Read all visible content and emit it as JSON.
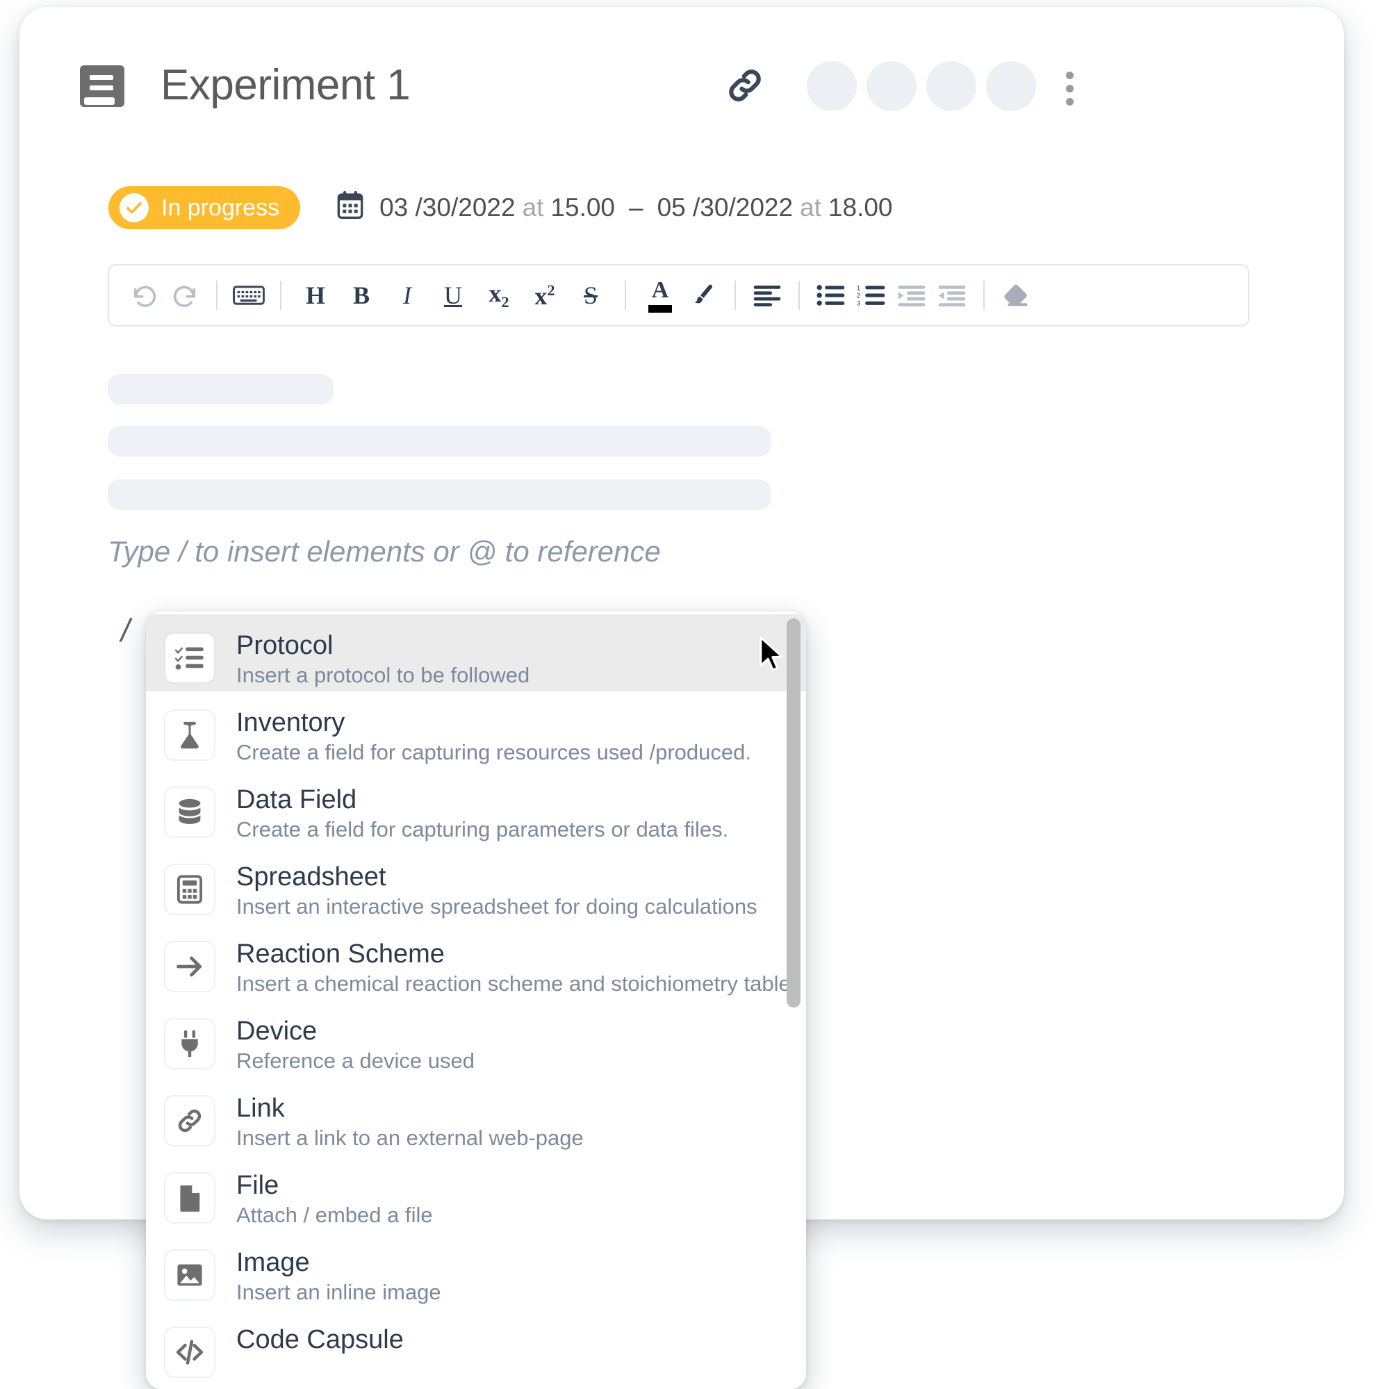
{
  "header": {
    "title": "Experiment 1",
    "book_icon": "book-icon",
    "link_icon": "link-icon",
    "more_icon": "more-vertical-icon",
    "avatar_count": 4
  },
  "meta": {
    "status_label": "In progress",
    "status_color": "#FDBB2D",
    "check_icon": "check-circle-icon",
    "calendar_icon": "calendar-icon",
    "start_date": "03 /30/2022",
    "start_at": "at",
    "start_time": "15.00",
    "range_dash": "–",
    "end_date": "05 /30/2022",
    "end_at": "at",
    "end_time": "18.00"
  },
  "toolbar": {
    "items": [
      {
        "name": "undo-icon",
        "label": "",
        "type": "icon"
      },
      {
        "name": "redo-icon",
        "label": "",
        "type": "icon"
      },
      {
        "name": "separator",
        "label": "",
        "type": "sep"
      },
      {
        "name": "keyboard-icon",
        "label": "",
        "type": "icon"
      },
      {
        "name": "separator",
        "label": "",
        "type": "sep"
      },
      {
        "name": "heading-button",
        "label": "H",
        "type": "text"
      },
      {
        "name": "bold-button",
        "label": "B",
        "type": "text"
      },
      {
        "name": "italic-button",
        "label": "I",
        "type": "text"
      },
      {
        "name": "underline-button",
        "label": "U",
        "type": "text"
      },
      {
        "name": "subscript-button",
        "label": "x2",
        "type": "text"
      },
      {
        "name": "superscript-button",
        "label": "x2",
        "type": "text"
      },
      {
        "name": "strikethrough-button",
        "label": "S",
        "type": "text"
      },
      {
        "name": "separator",
        "label": "",
        "type": "sep"
      },
      {
        "name": "text-color-button",
        "label": "A",
        "type": "text"
      },
      {
        "name": "highlight-brush-icon",
        "label": "",
        "type": "icon"
      },
      {
        "name": "separator",
        "label": "",
        "type": "sep"
      },
      {
        "name": "align-left-icon",
        "label": "",
        "type": "icon"
      },
      {
        "name": "separator",
        "label": "",
        "type": "sep"
      },
      {
        "name": "bulleted-list-icon",
        "label": "",
        "type": "icon"
      },
      {
        "name": "numbered-list-icon",
        "label": "",
        "type": "icon"
      },
      {
        "name": "indent-icon",
        "label": "",
        "type": "icon"
      },
      {
        "name": "outdent-icon",
        "label": "",
        "type": "icon"
      },
      {
        "name": "separator",
        "label": "",
        "type": "sep"
      },
      {
        "name": "eraser-icon",
        "label": "",
        "type": "icon"
      }
    ]
  },
  "editor": {
    "hint": "Type / to insert elements or @ to reference",
    "typed_text": "/"
  },
  "slash_menu": {
    "items": [
      {
        "title": "Protocol",
        "desc": "Insert a protocol to be followed",
        "icon": "checklist-icon",
        "active": true
      },
      {
        "title": "Inventory",
        "desc": "Create a field for capturing resources used /produced.",
        "icon": "flask-icon",
        "active": false
      },
      {
        "title": "Data Field",
        "desc": "Create a field for capturing parameters or data files.",
        "icon": "database-icon",
        "active": false
      },
      {
        "title": "Spreadsheet",
        "desc": "Insert an interactive spreadsheet for doing calculations",
        "icon": "calculator-icon",
        "active": false
      },
      {
        "title": "Reaction Scheme",
        "desc": "Insert a chemical reaction scheme and stoichiometry table",
        "icon": "arrow-right-icon",
        "active": false
      },
      {
        "title": "Device",
        "desc": "Reference a device used",
        "icon": "plug-icon",
        "active": false
      },
      {
        "title": "Link",
        "desc": "Insert a link to an external web-page",
        "icon": "link-icon",
        "active": false
      },
      {
        "title": "File",
        "desc": "Attach / embed a file",
        "icon": "file-icon",
        "active": false
      },
      {
        "title": "Image",
        "desc": "Insert an inline image",
        "icon": "image-icon",
        "active": false
      },
      {
        "title": "Code Capsule",
        "desc": "",
        "icon": "code-brackets-icon",
        "active": false
      }
    ]
  }
}
